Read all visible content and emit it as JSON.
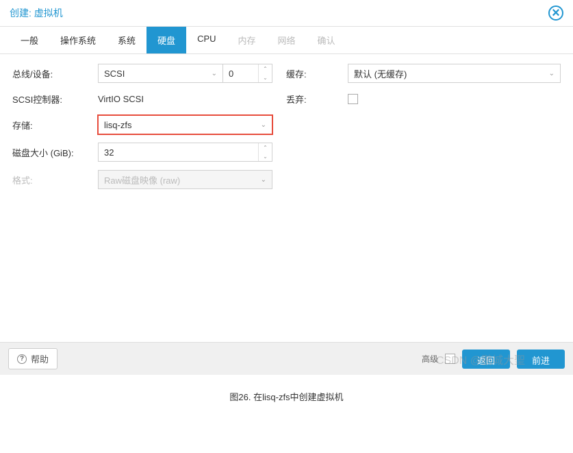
{
  "header": {
    "title": "创建: 虚拟机"
  },
  "tabs": {
    "general": "一般",
    "os": "操作系统",
    "system": "系统",
    "disk": "硬盘",
    "cpu": "CPU",
    "memory": "内存",
    "network": "网络",
    "confirm": "确认"
  },
  "form": {
    "bus_label": "总线/设备:",
    "bus_value": "SCSI",
    "bus_index": "0",
    "scsi_label": "SCSI控制器:",
    "scsi_value": "VirtIO SCSI",
    "storage_label": "存储:",
    "storage_value": "lisq-zfs",
    "size_label": "磁盘大小 (GiB):",
    "size_value": "32",
    "format_label": "格式:",
    "format_value": "Raw磁盘映像 (raw)",
    "cache_label": "缓存:",
    "cache_value": "默认 (无缓存)",
    "discard_label": "丢弃:"
  },
  "footer": {
    "help": "帮助",
    "advanced": "高级",
    "back": "返回",
    "next": "前进"
  },
  "watermark": "CSDN @鵬城大聖",
  "caption": "图26. 在lisq-zfs中创建虚拟机"
}
